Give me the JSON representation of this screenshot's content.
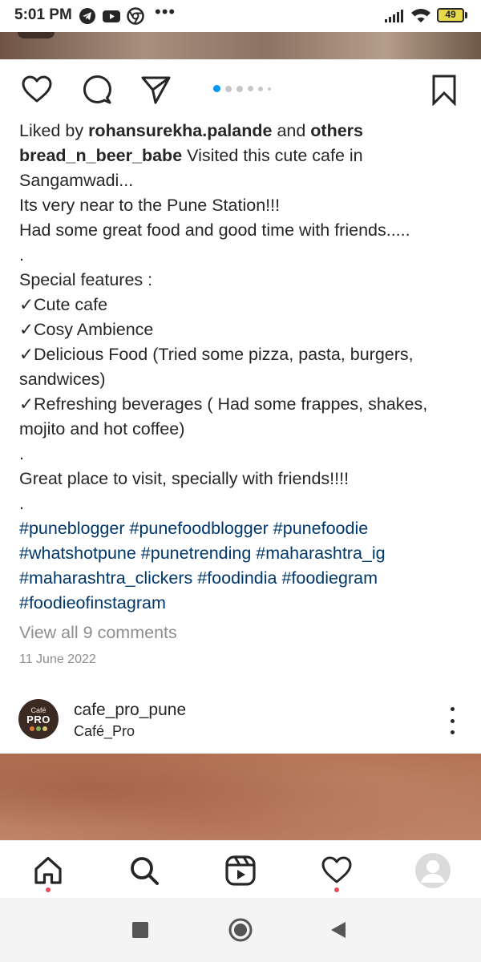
{
  "status_bar": {
    "time": "5:01 PM",
    "battery": "49",
    "left_icons": [
      "telegram-icon",
      "youtube-icon",
      "chrome-icon"
    ],
    "more": "•••"
  },
  "post": {
    "carousel": {
      "total": 6,
      "active": 1
    },
    "liked_by": {
      "prefix": "Liked by ",
      "user": "rohansurekha.palande",
      "middle": " and ",
      "suffix": "others"
    },
    "caption": {
      "username": "bread_n_beer_babe",
      "first_line": " Visited this cute cafe in",
      "lines": [
        "Sangamwadi...",
        "Its very near to the Pune Station!!!",
        "Had some great food and good time with friends.....",
        ".",
        "Special features :",
        "✓Cute cafe",
        "✓Cosy Ambience",
        "✓Delicious Food (Tried some pizza, pasta, burgers,",
        "sandwices)",
        "✓Refreshing beverages ( Had some frappes, shakes,",
        "mojito and hot coffee)",
        ".",
        "Great place to visit, specially with friends!!!!",
        "."
      ],
      "hashtag_lines": [
        "#puneblogger #punefoodblogger #punefoodie",
        "#whatshotpune #punetrending #maharashtra_ig",
        "#maharashtra_clickers #foodindia #foodiegram",
        "#foodieofinstagram"
      ]
    },
    "view_comments": "View all 9 comments",
    "date": "11 June 2022"
  },
  "next_post": {
    "avatar": {
      "line1": "Café",
      "line2": "PRO"
    },
    "username": "cafe_pro_pune",
    "subtitle": "Café_Pro"
  },
  "bottom_nav": [
    "home-icon",
    "search-icon",
    "reels-icon",
    "heart-icon",
    "profile-avatar"
  ],
  "colors": {
    "text": "#262626",
    "hashtag": "#00376b",
    "muted": "#8e8e8e",
    "active_dot": "#0095f6",
    "notification": "#ed4956"
  }
}
